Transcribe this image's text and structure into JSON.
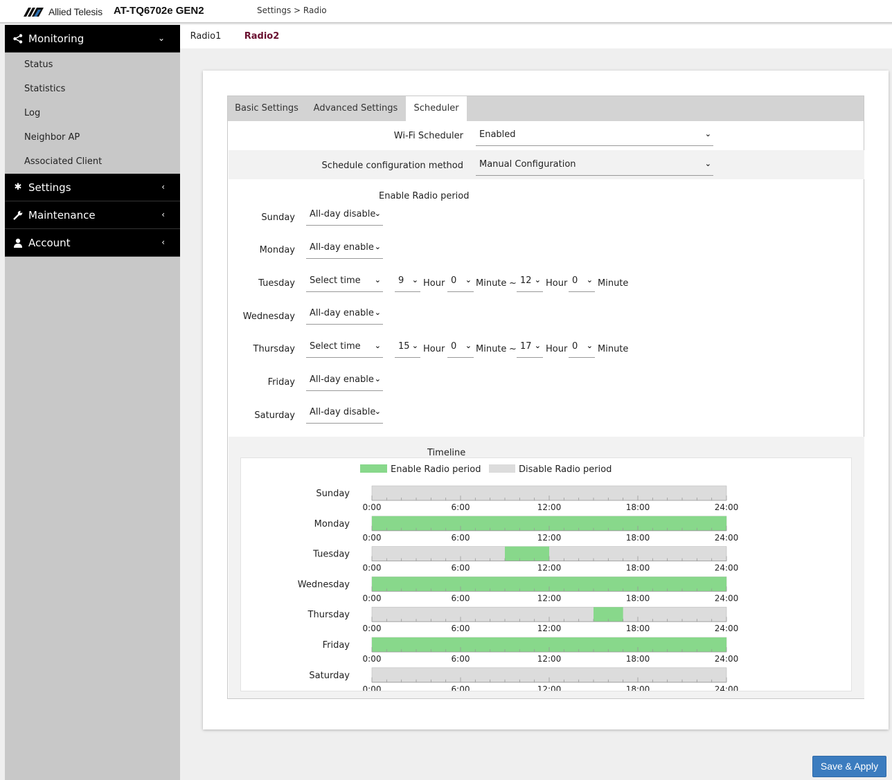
{
  "header": {
    "brand": "Allied Telesis",
    "model": "AT-TQ6702e GEN2",
    "breadcrumb": "Settings > Radio"
  },
  "sidebar": {
    "sections": [
      {
        "label": "Monitoring",
        "icon": "share-icon",
        "chevron": "chevron-down-icon",
        "items": [
          "Status",
          "Statistics",
          "Log",
          "Neighbor AP",
          "Associated Client"
        ]
      },
      {
        "label": "Settings",
        "icon": "gear-icon",
        "chevron": "chevron-left-icon"
      },
      {
        "label": "Maintenance",
        "icon": "wrench-icon",
        "chevron": "chevron-left-icon"
      },
      {
        "label": "Account",
        "icon": "user-icon",
        "chevron": "chevron-left-icon"
      }
    ]
  },
  "radio_tabs": [
    "Radio1",
    "Radio2"
  ],
  "radio_tab_active": "Radio2",
  "sub_tabs": [
    "Basic Settings",
    "Advanced Settings",
    "Scheduler"
  ],
  "sub_tab_active": "Scheduler",
  "scheduler": {
    "wifi_scheduler_label": "Wi-Fi Scheduler",
    "wifi_scheduler_value": "Enabled",
    "method_label": "Schedule configuration method",
    "method_value": "Manual Configuration",
    "period_title": "Enable Radio period",
    "units": {
      "hour": "Hour",
      "minute": "Minute",
      "tilde": "~"
    },
    "days": [
      {
        "day": "Sunday",
        "mode": "All-day disable"
      },
      {
        "day": "Monday",
        "mode": "All-day enable"
      },
      {
        "day": "Tuesday",
        "mode": "Select time",
        "start_hour": "9",
        "start_minute": "0",
        "end_hour": "12",
        "end_minute": "0"
      },
      {
        "day": "Wednesday",
        "mode": "All-day enable"
      },
      {
        "day": "Thursday",
        "mode": "Select time",
        "start_hour": "15",
        "start_minute": "0",
        "end_hour": "17",
        "end_minute": "0"
      },
      {
        "day": "Friday",
        "mode": "All-day enable"
      },
      {
        "day": "Saturday",
        "mode": "All-day disable"
      }
    ]
  },
  "timeline": {
    "title": "Timeline",
    "legend_enable": "Enable Radio period",
    "legend_disable": "Disable Radio period",
    "ticks": [
      "0:00",
      "6:00",
      "12:00",
      "18:00",
      "24:00"
    ],
    "enable_color": "#88d88b",
    "disable_color": "#dcdcdc"
  },
  "chart_data": {
    "type": "bar",
    "title": "Timeline",
    "categories": [
      "Sunday",
      "Monday",
      "Tuesday",
      "Wednesday",
      "Thursday",
      "Friday",
      "Saturday"
    ],
    "x_range": [
      0,
      24
    ],
    "x_ticks": [
      "0:00",
      "6:00",
      "12:00",
      "18:00",
      "24:00"
    ],
    "series": [
      {
        "name": "Enable Radio period",
        "color": "#88d88b",
        "intervals": [
          [],
          [
            [
              0,
              24
            ]
          ],
          [
            [
              9,
              12
            ]
          ],
          [
            [
              0,
              24
            ]
          ],
          [
            [
              15,
              17
            ]
          ],
          [
            [
              0,
              24
            ]
          ],
          []
        ]
      },
      {
        "name": "Disable Radio period",
        "color": "#dcdcdc"
      }
    ],
    "legend": "top"
  },
  "actions": {
    "save": "Save & Apply"
  },
  "colors": {
    "accent": "#3b7cbf",
    "active_tab": "#6a1030"
  }
}
